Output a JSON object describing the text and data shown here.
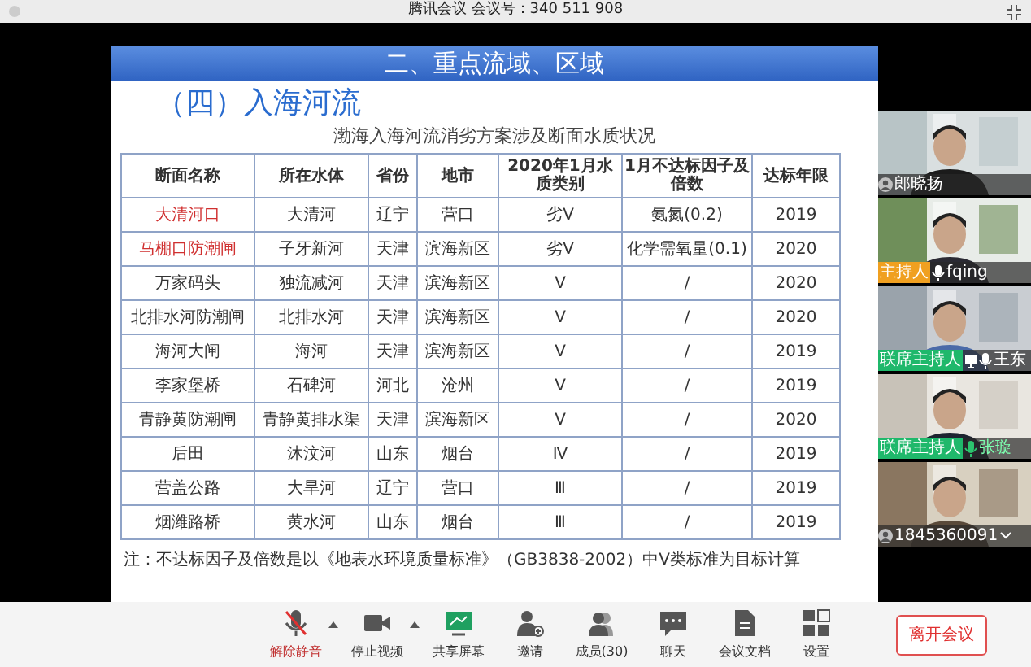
{
  "window": {
    "title": "腾讯会议 会议号：340 511 908"
  },
  "slide": {
    "header": "二、重点流域、区域",
    "subtitle": "（四）入海河流",
    "table_title": "渤海入海河流消劣方案涉及断面水质状况",
    "columns": [
      "断面名称",
      "所在水体",
      "省份",
      "地市",
      "2020年1月水质类别",
      "1月不达标因子及倍数",
      "达标年限"
    ],
    "rows": [
      {
        "highlight": true,
        "cells": [
          "大清河口",
          "大清河",
          "辽宁",
          "营口",
          "劣V",
          "氨氮(0.2)",
          "2019"
        ]
      },
      {
        "highlight": true,
        "cells": [
          "马棚口防潮闸",
          "子牙新河",
          "天津",
          "滨海新区",
          "劣V",
          "化学需氧量(0.1)",
          "2020"
        ]
      },
      {
        "highlight": false,
        "cells": [
          "万家码头",
          "独流减河",
          "天津",
          "滨海新区",
          "V",
          "/",
          "2020"
        ]
      },
      {
        "highlight": false,
        "cells": [
          "北排水河防潮闸",
          "北排水河",
          "天津",
          "滨海新区",
          "V",
          "/",
          "2020"
        ]
      },
      {
        "highlight": false,
        "cells": [
          "海河大闸",
          "海河",
          "天津",
          "滨海新区",
          "V",
          "/",
          "2019"
        ]
      },
      {
        "highlight": false,
        "cells": [
          "李家堡桥",
          "石碑河",
          "河北",
          "沧州",
          "V",
          "/",
          "2019"
        ]
      },
      {
        "highlight": false,
        "cells": [
          "青静黄防潮闸",
          "青静黄排水渠",
          "天津",
          "滨海新区",
          "V",
          "/",
          "2020"
        ]
      },
      {
        "highlight": false,
        "cells": [
          "后田",
          "沐汶河",
          "山东",
          "烟台",
          "Ⅳ",
          "/",
          "2019"
        ]
      },
      {
        "highlight": false,
        "cells": [
          "营盖公路",
          "大旱河",
          "辽宁",
          "营口",
          "Ⅲ",
          "/",
          "2019"
        ]
      },
      {
        "highlight": false,
        "cells": [
          "烟潍路桥",
          "黄水河",
          "山东",
          "烟台",
          "Ⅲ",
          "/",
          "2019"
        ]
      }
    ],
    "note": "注：不达标因子及倍数是以《地表水环境质量标准》（GB3838-2002）中V类标准为目标计算"
  },
  "participants": [
    {
      "name": "郎晓扬",
      "kind": "avatar",
      "sharing": false,
      "speaking": false,
      "more": false
    },
    {
      "name": "fqing",
      "kind": "mic",
      "role": "主持人",
      "color": "#f0a020",
      "sharing": false,
      "speaking": false,
      "more": false
    },
    {
      "name": "王东",
      "kind": "mic",
      "role": "联席主持人",
      "color": "#1fb86b",
      "sharing": true,
      "speaking": false,
      "more": false
    },
    {
      "name": "张璇",
      "kind": "mic",
      "role": "联席主持人",
      "color": "#1fb86b",
      "sharing": false,
      "speaking": true,
      "more": false
    },
    {
      "name": "1845360091",
      "kind": "avatar",
      "sharing": false,
      "speaking": false,
      "more": true
    }
  ],
  "toolbar": [
    {
      "kind": "mic",
      "label": "解除静音",
      "muted": true,
      "caret": true
    },
    {
      "kind": "video",
      "label": "停止视频",
      "muted": false,
      "caret": true
    },
    {
      "kind": "share",
      "label": "共享屏幕",
      "muted": false,
      "caret": false
    },
    {
      "kind": "invite",
      "label": "邀请",
      "muted": false,
      "caret": false
    },
    {
      "kind": "members",
      "label": "成员(30)",
      "muted": false,
      "caret": false
    },
    {
      "kind": "chat",
      "label": "聊天",
      "muted": false,
      "caret": false
    },
    {
      "kind": "doc",
      "label": "会议文档",
      "muted": false,
      "caret": false
    },
    {
      "kind": "settings",
      "label": "设置",
      "muted": false,
      "caret": false
    }
  ],
  "leave_button": "离开会议"
}
